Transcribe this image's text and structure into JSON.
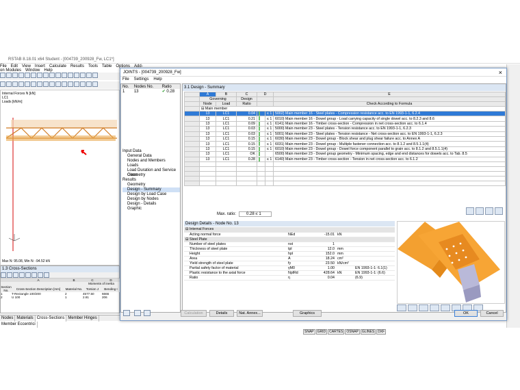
{
  "app": {
    "title": "RSTAB 8.18.01 x64 Student - [004739_200928_Fw, LC1*]",
    "menu": [
      "File",
      "Edit",
      "View",
      "Insert",
      "Calculate",
      "Results",
      "Tools",
      "Table",
      "Options",
      "Add-on Modules",
      "Window",
      "Help"
    ],
    "canvas": {
      "info1": "Internal Forces N [kN]",
      "info2": "LC1",
      "info3": "Loads [kN/m]",
      "footer": "Max N: 95.08, Min N: -94.52 kN"
    },
    "cross_sections": {
      "title": "1.3 Cross-Sections",
      "headers": [
        "Section No.",
        "Cross-Section Description [mm]",
        "Material No.",
        "Torsion J",
        "Bending I"
      ],
      "col_letters": [
        "A",
        "B",
        "C",
        "D"
      ],
      "top_header": "Moments of inertia",
      "rows": [
        [
          "1",
          "T-Rectangle 100/200",
          "2",
          "4577.50",
          "6666"
        ],
        [
          "2",
          "U 100",
          "1",
          "2.81",
          "206"
        ]
      ]
    },
    "bottom_tabs": [
      "Nodes",
      "Materials",
      "Cross-Sections",
      "Member Hinges",
      "Member Eccentrici"
    ],
    "status": [
      "SNAP",
      "GRID",
      "CARTES",
      "OSNAP",
      "GLINES",
      "DXF"
    ]
  },
  "dialog": {
    "title": "JOINTS - [004739_200928_Fw]",
    "menu": [
      "File",
      "Settings",
      "Help"
    ],
    "nav_header": {
      "no": "No.",
      "nodes": "Nodes No.",
      "ratio": "Ratio"
    },
    "nav_row": {
      "no": "1",
      "nodes": "13",
      "ratio": "0.28"
    },
    "nav_tree": [
      {
        "label": "Input Data",
        "level": 0
      },
      {
        "label": "General Data",
        "level": 1
      },
      {
        "label": "Nodes and Members",
        "level": 1
      },
      {
        "label": "Loads",
        "level": 1
      },
      {
        "label": "Load Duration and Service Class",
        "level": 1
      },
      {
        "label": "Geometry",
        "level": 1
      },
      {
        "label": "Results",
        "level": 0
      },
      {
        "label": "Geometry",
        "level": 1
      },
      {
        "label": "Design - Summary",
        "level": 1
      },
      {
        "label": "Design by Load Case",
        "level": 1
      },
      {
        "label": "Design by Nodes",
        "level": 1
      },
      {
        "label": "Design - Details",
        "level": 1
      },
      {
        "label": "Graphic",
        "level": 1
      }
    ],
    "results": {
      "title": "3.1 Design - Summary",
      "col_letters": [
        "A",
        "B",
        "C",
        "D",
        "E"
      ],
      "h1": {
        "governing": "Governing",
        "design": "Design"
      },
      "h2": {
        "node": "Node",
        "load": "Load",
        "ratio": "Ratio",
        "formula": "Check According to Formula"
      },
      "group": "Main member",
      "rows": [
        {
          "node": "13",
          "load": "LC1",
          "ratio": "0.04",
          "le": "≤ 1",
          "formula": "5002) Main member 16 - Steel plates - Compression resistance acc. to EN 1993-1-1, 6.2.4"
        },
        {
          "node": "13",
          "load": "LC1",
          "ratio": "0.21",
          "le": "≤ 1",
          "formula": "6010) Main member 16 - Dowel group - Load carrying capacity of single dowel acc. to 8.2.3 and 8.6"
        },
        {
          "node": "13",
          "load": "LC1",
          "ratio": "0.09",
          "le": "≤ 1",
          "formula": "6141) Main member 16 - Timber cross-section - Compression in net cross-section acc. to 6.1.4"
        },
        {
          "node": "13",
          "load": "LC1",
          "ratio": "0.03",
          "le": "≤ 1",
          "formula": "5000) Main member 23 - Steel plates - Tension resistance acc. to EN 1993-1-1, 6.2.3"
        },
        {
          "node": "13",
          "load": "LC1",
          "ratio": "0.03",
          "le": "≤ 1",
          "formula": "5001) Main member 23 - Steel plates - Tension resistance - Net cross-section acc. to EN 1993-1-1, 6.2.3"
        },
        {
          "node": "13",
          "load": "LC1",
          "ratio": "0.15",
          "le": "≤ 1",
          "formula": "6030) Main member 23 - Dowel group - Block shear and plug shear failure acc. to Annex A"
        },
        {
          "node": "13",
          "load": "LC1",
          "ratio": "0.15",
          "le": "≤ 1",
          "formula": "6031) Main member 23 - Dowel group - Multiple fastener connection acc. to 8.1.2 and 8.5.1.1(4)"
        },
        {
          "node": "13",
          "load": "LC1",
          "ratio": "0.15",
          "le": "≤ 1",
          "formula": "6010) Main member 23 - Dowel group - Dowel force component parallel to grain acc. to 8.1.2 and 8.5.1.1(4)"
        },
        {
          "node": "13",
          "load": "LC1",
          "ratio": "OK",
          "le": "",
          "formula": "6500) Main member 23 - Dowel group geometry - Minimum spacing, edge and end distances for dowels acc. to Tab. 8.5"
        },
        {
          "node": "13",
          "load": "LC1",
          "ratio": "0.28",
          "le": "≤ 1",
          "formula": "6140) Main member 23 - Timber cross-section - Tension in net cross-section acc. to 6.1.2"
        }
      ],
      "max_ratio_label": "Max. ratio:",
      "max_ratio_value": "0.28 ≤ 1"
    },
    "details": {
      "title": "Design Details  -  Node No. 13",
      "sections": [
        "Internal Forces",
        "Steel Plate"
      ],
      "rows": [
        {
          "sec": 0,
          "label": "Acting normal force",
          "sym": "NEd",
          "val": "-15.01",
          "unit": "kN",
          "ref": ""
        },
        {
          "sec": 1,
          "label": "Number of steel plates",
          "sym": "nst",
          "val": "1",
          "unit": "",
          "ref": ""
        },
        {
          "sec": 1,
          "label": "Thickness of steel plate",
          "sym": "tpl",
          "val": "12.0",
          "unit": "mm",
          "ref": ""
        },
        {
          "sec": 1,
          "label": "Height",
          "sym": "hpl",
          "val": "152.0",
          "unit": "mm",
          "ref": ""
        },
        {
          "sec": 1,
          "label": "Area",
          "sym": "A",
          "val": "18.24",
          "unit": "cm²",
          "ref": ""
        },
        {
          "sec": 1,
          "label": "Yield strength of steel plate",
          "sym": "fy",
          "val": "23.50",
          "unit": "kN/cm²",
          "ref": ""
        },
        {
          "sec": 1,
          "label": "Partial safety factor of material",
          "sym": "γM0",
          "val": "1.00",
          "unit": "",
          "ref": "EN 1993-1-1: 6.1(1)"
        },
        {
          "sec": 1,
          "label": "Plastic resistance to the axial force",
          "sym": "NplRd",
          "val": "428.64",
          "unit": "kN",
          "ref": "EN 1993-1-1: (6.6)"
        },
        {
          "sec": 1,
          "label": "Ratio",
          "sym": "η",
          "val": "0.04",
          "unit": "",
          "ref": "(6.9)"
        }
      ]
    },
    "buttons": {
      "calculation": "Calculation",
      "details": "Details",
      "nat_annex": "Nat. Annex...",
      "graphics": "Graphics",
      "ok": "OK",
      "cancel": "Cancel"
    }
  }
}
